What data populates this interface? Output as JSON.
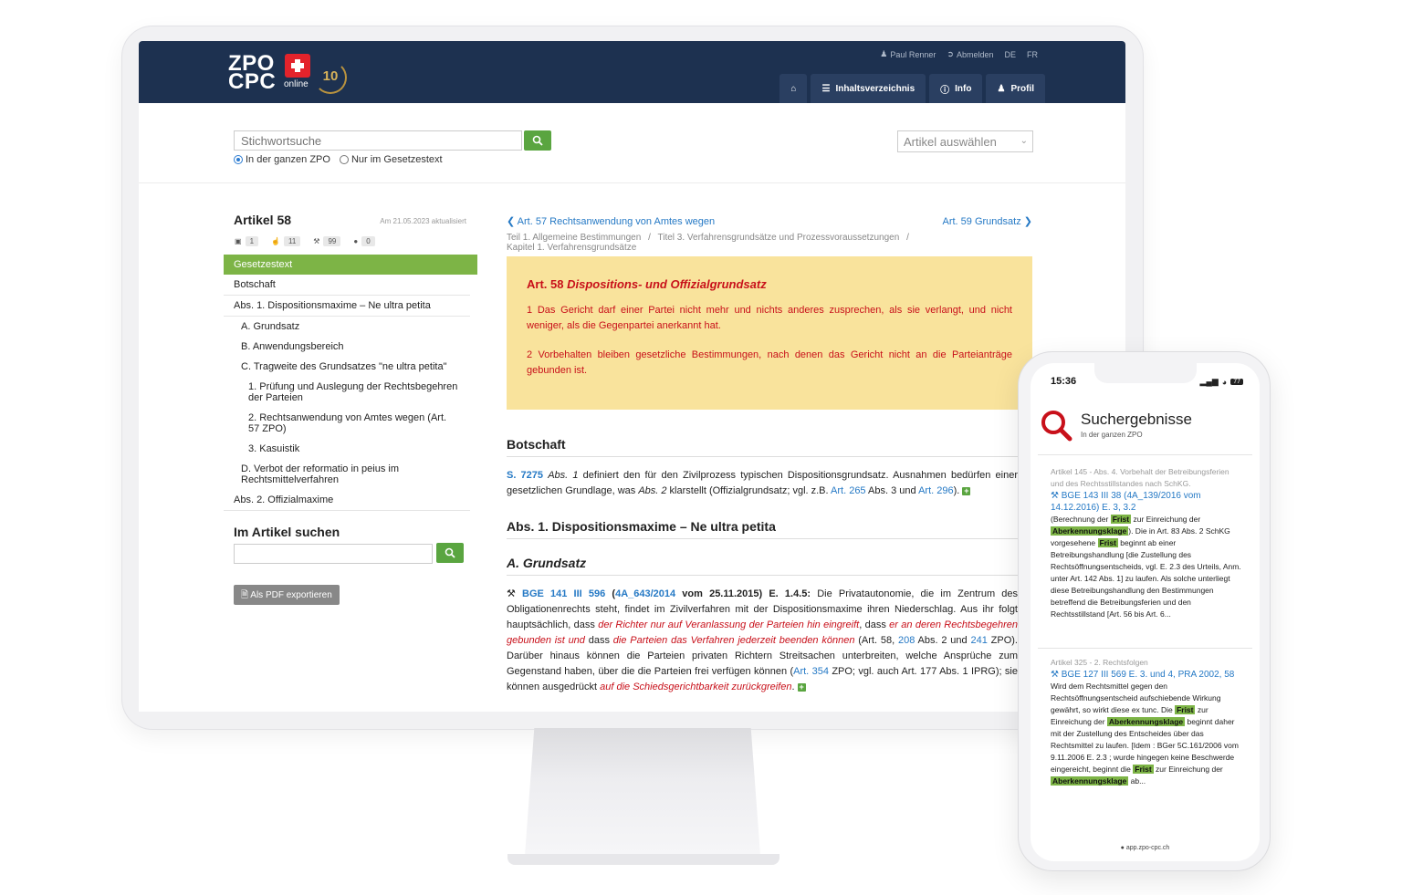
{
  "header": {
    "logo": {
      "line1": "ZPO",
      "line2": "CPC",
      "online": "online",
      "badge": "10"
    },
    "user": "Paul Renner",
    "logout": "Abmelden",
    "lang_de": "DE",
    "lang_fr": "FR",
    "nav": {
      "toc": "Inhaltsverzeichnis",
      "info": "Info",
      "profile": "Profil"
    }
  },
  "search": {
    "placeholder": "Stichwortsuche",
    "scope_all": "In der ganzen ZPO",
    "scope_law": "Nur im Gesetzestext",
    "article_select": "Artikel auswählen"
  },
  "sidebar": {
    "title": "Artikel 58",
    "updated": "Am 21.05.2023 aktualisiert",
    "counts": {
      "books": "1",
      "likes": "11",
      "rulings": "99",
      "comments": "0"
    },
    "toc": [
      {
        "label": "Gesetzestext"
      },
      {
        "label": "Botschaft"
      },
      {
        "label": "Abs. 1. Dispositionsmaxime – Ne ultra petita"
      },
      {
        "label": "A. Grundsatz"
      },
      {
        "label": "B. Anwendungsbereich"
      },
      {
        "label": "C. Tragweite des Grundsatzes \"ne ultra petita\""
      },
      {
        "label": "1. Prüfung und Auslegung der Rechtsbegehren der Parteien"
      },
      {
        "label": "2. Rechtsanwendung von Amtes wegen (Art. 57 ZPO)"
      },
      {
        "label": "3. Kasuistik"
      },
      {
        "label": "D. Verbot der reformatio in peius im Rechtsmittelverfahren"
      },
      {
        "label": "Abs. 2. Offizialmaxime"
      }
    ],
    "search_title": "Im Artikel suchen",
    "pdf_button": "Als PDF exportieren"
  },
  "main": {
    "prev_article": "Art. 57 Rechtsanwendung von Amtes wegen",
    "next_article": "Art. 59 Grundsatz",
    "breadcrumb": {
      "part": "Teil 1. Allgemeine Bestimmungen",
      "title": "Titel 3. Verfahrensgrundsätze und Prozessvoraussetzungen",
      "chapter": "Kapitel 1. Verfahrensgrundsätze",
      "sep": "/"
    },
    "law": {
      "art_no": "Art. 58",
      "heading": "Dispositions- und Offizialgrundsatz",
      "para1": "1 Das Gericht darf einer Partei nicht mehr und nichts anderes zusprechen, als sie verlangt, und nicht weniger, als die Gegenpartei anerkannt hat.",
      "para2": "2 Vorbehalten bleiben gesetzliche Bestimmungen, nach denen das Gericht nicht an die Parteianträge gebunden ist."
    },
    "botschaft_title": "Botschaft",
    "botschaft_text": {
      "ref": "S. 7275",
      "abs": "Abs. 1",
      "t1": " definiert den für den Zivilprozess typischen Dispositionsgrundsatz. Ausnahmen bedürfen einer gesetzlichen Grundlage, was ",
      "abs2": "Abs. 2",
      "t2": " klarstellt (Offizialgrundsatz; vgl. z.B. ",
      "art265": "Art. 265",
      "t3": " Abs. 3 und ",
      "art296": "Art. 296",
      "t4": ")."
    },
    "abs1_title": "Abs. 1. Dispositionsmaxime – Ne ultra petita",
    "grundsatz_title": "A. Grundsatz",
    "bge": {
      "ref": "BGE 141 III 596",
      "case": "4A_643/2014",
      "date": " vom 25.11.2015) E. 1.4.5:",
      "t1": " Die Privatautonomie, die im Zentrum des Obligationenrechts steht, findet im Zivilverfahren mit der Dispositionsmaxime ihren Niederschlag. Aus ihr folgt hauptsächlich, dass ",
      "r1": "der Richter nur auf Veranlassung der Parteien hin eingreift",
      "t2": ", dass ",
      "r2": "er an deren Rechtsbegehren gebunden ist und",
      "t3": " dass ",
      "r3": "die Parteien das Verfahren jederzeit beenden können",
      "t4": " (Art. 58, ",
      "a208": "208",
      "t5": " Abs. 2 und ",
      "a241": "241",
      "t6": " ZPO). Darüber hinaus können die Parteien privaten Richtern Streitsachen unterbreiten, welche Ansprüche zum Gegenstand haben, über die die Parteien frei verfügen können (",
      "a354": "Art. 354",
      "t7": " ZPO; vgl. auch Art. 177 Abs. 1 IPRG); sie können ausgedrückt ",
      "r4": "auf die Schiedsgerichtbarkeit zurückgreifen",
      "t8": "."
    }
  },
  "phone": {
    "time": "15:36",
    "battery": "77",
    "title": "Suchergebnisse",
    "subtitle": "In der ganzen ZPO",
    "results": [
      {
        "meta": "Artikel 145 - Abs. 4. Vorbehalt der Betreibungsferien und des Rechtsstillstandes nach SchKG.",
        "ref": "BGE 143 III 38 (4A_139/2016 vom 14.12.2016) E. 3, 3.2",
        "t1": "(Berechnung der ",
        "h1": "Frist",
        "t2": " zur Einreichung der ",
        "h2": "Aberkennungsklage",
        "t3": "). Die in Art. 83 Abs. 2 SchKG vorgesehene ",
        "h3": "Frist",
        "t4": " beginnt ab einer Betreibungshandlung [die Zustellung des Rechtsöffnungsentscheids, vgl. E. 2.3 des Urteils, Anm. unter Art. 142 Abs. 1] zu laufen. Als solche unterliegt diese Betreibungshandlung den Bestimmungen betreffend die Betreibungsferien und den Rechtsstillstand [Art. 56 bis Art. 6..."
      },
      {
        "meta": "Artikel 325 - 2. Rechtsfolgen",
        "ref": "BGE 127 III 569 E. 3. und 4, PRA 2002, 58",
        "t1": "Wird dem Rechtsmittel gegen den Rechtsöffnungsentscheid aufschiebende Wirkung gewährt, so wirkt diese ex tunc. Die ",
        "h1": "Frist",
        "t2": " zur Einreichung der ",
        "h2": "Aberkennungsklage",
        "t3": " beginnt daher mit der Zustellung des Entscheides über das Rechtsmittel zu laufen. [Idem : BGer 5C.161/2006 vom 9.11.2006 E. 2.3 ; wurde hingegen keine Beschwerde eingereicht, beginnt die ",
        "h3": "Frist",
        "t4": " zur Einreichung der ",
        "h4": "Aberkennungsklage",
        "t5": " ab..."
      }
    ],
    "url": "app.zpo-cpc.ch"
  }
}
